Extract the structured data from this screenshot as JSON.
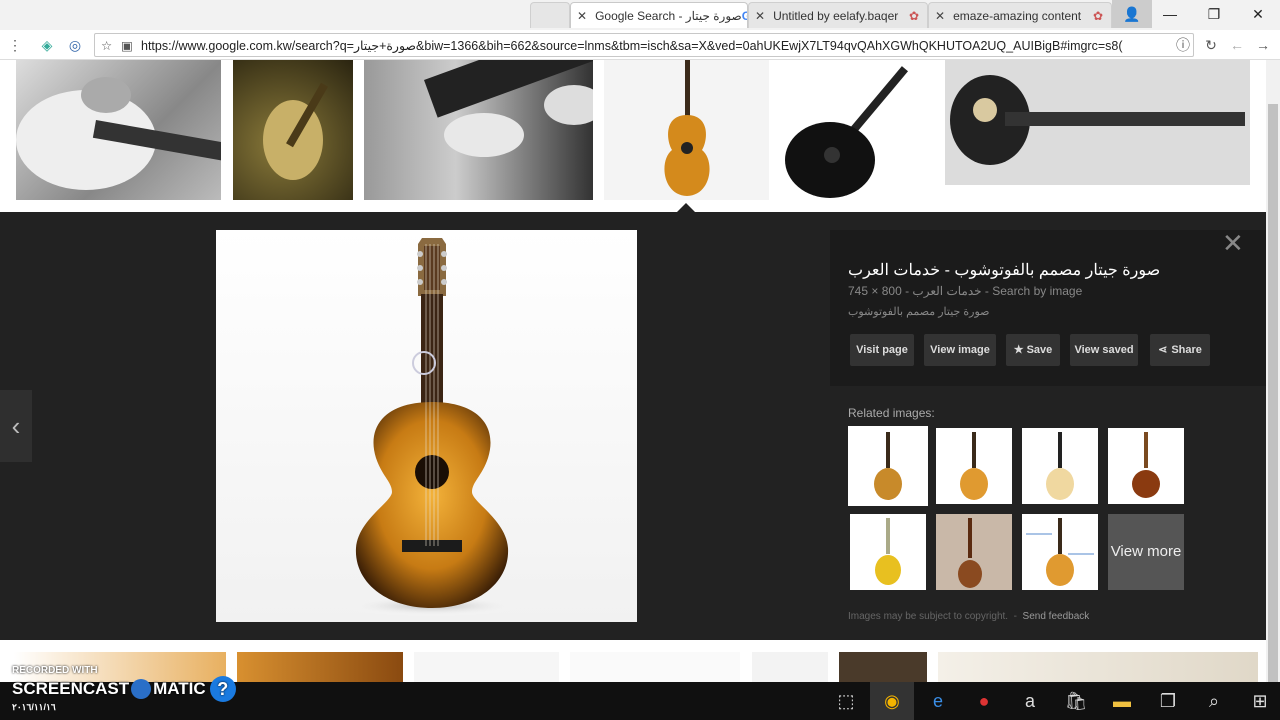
{
  "browser": {
    "tabs": [
      {
        "label": "صورة جيتار - Google Search",
        "active": true
      },
      {
        "label": "Untitled by eelafy.baqer",
        "active": false
      },
      {
        "label": "emaze-amazing content",
        "active": false
      }
    ],
    "url": "https://www.google.com.kw/search?q=صورة+جيتار&biw=1366&bih=662&source=lnms&tbm=isch&sa=X&ved=0ahUKEwjX7LT94qvQAhXGWhQKHUTOA2UQ_AUIBigB#imgrc=s8("
  },
  "preview": {
    "title": "صورة جيتار مصمم بالفوتوشوب - خدمات العرب",
    "meta": "خدمات العرب - 800 × 745 - Search by image",
    "description": "صورة جيتار مصمم بالفوتوشوب",
    "buttons": {
      "visit": "Visit page",
      "view_image": "View image",
      "save": "Save",
      "view_saved": "View saved",
      "share": "Share"
    },
    "related_label": "Related images:",
    "view_more": "View more",
    "copyright": "Images may be subject to copyright.",
    "feedback": "Send feedback"
  },
  "watermark": {
    "line1": "RECORDED WITH",
    "line2": "SCREENCAST",
    "line3": "MATIC",
    "date": "٢٠١٦/١١/١٦"
  },
  "icons": [
    "close-icon",
    "star-icon",
    "share-icon",
    "chevron-left-icon",
    "chevron-right-icon",
    "reload-icon",
    "info-icon"
  ]
}
